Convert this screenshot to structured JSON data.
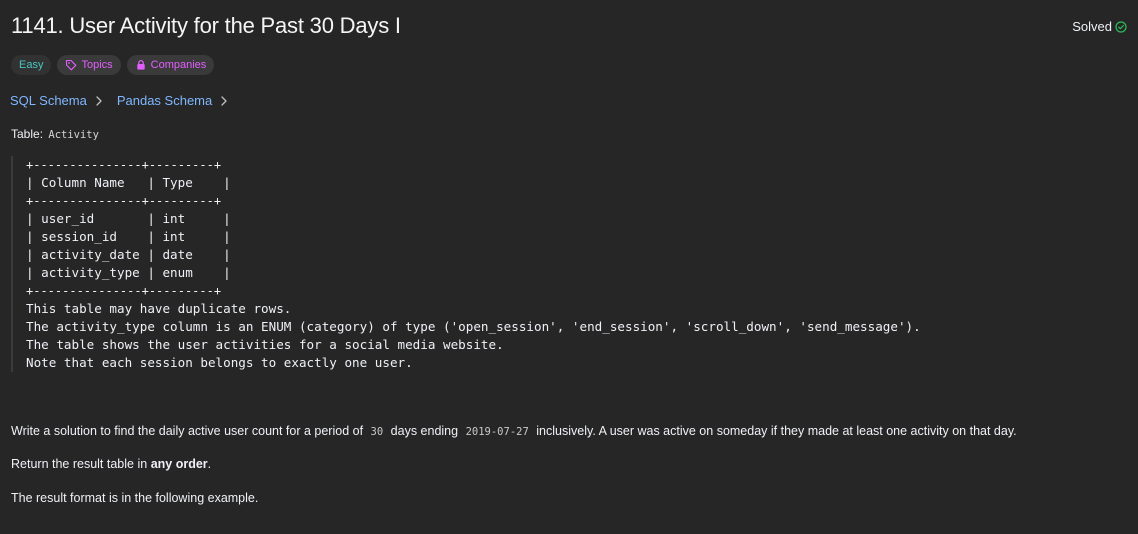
{
  "problem": {
    "title": "1141. User Activity for the Past 30 Days I",
    "status": "Solved",
    "tags": {
      "difficulty": "Easy",
      "topics": "Topics",
      "companies": "Companies"
    }
  },
  "schemas": {
    "sql": "SQL Schema",
    "pandas": "Pandas Schema"
  },
  "table_intro": {
    "label": "Table:",
    "name": "Activity"
  },
  "schema_block": {
    "border": "+---------------+---------+",
    "header": "| Column Name   | Type    |",
    "rows": [
      "| user_id       | int     |",
      "| session_id    | int     |",
      "| activity_date | date    |",
      "| activity_type | enum    |"
    ],
    "notes": [
      "This table may have duplicate rows.",
      "The activity_type column is an ENUM (category) of type ('open_session', 'end_session', 'scroll_down', 'send_message').",
      "The table shows the user activities for a social media website.",
      "Note that each session belongs to exactly one user."
    ]
  },
  "description": {
    "p1_a": "Write a solution to find the daily active user count for a period of",
    "p1_days": "30",
    "p1_b": "days ending",
    "p1_date": "2019-07-27",
    "p1_c": "inclusively. A user was active on someday if they made at least one activity on that day.",
    "p2_a": "Return the result table in",
    "p2_bold": "any order",
    "p2_b": ".",
    "p3": "The result format is in the following example."
  },
  "colors": {
    "background": "#262626",
    "easy": "#46c6c2",
    "tag_link": "#e25fff",
    "schema_link": "#7fb7ff",
    "solved_check": "#2cbb5d"
  },
  "icons": {
    "solved": "check-circle-icon",
    "topics": "tag-icon",
    "companies": "lock-icon",
    "chevron": "chevron-right-icon"
  }
}
